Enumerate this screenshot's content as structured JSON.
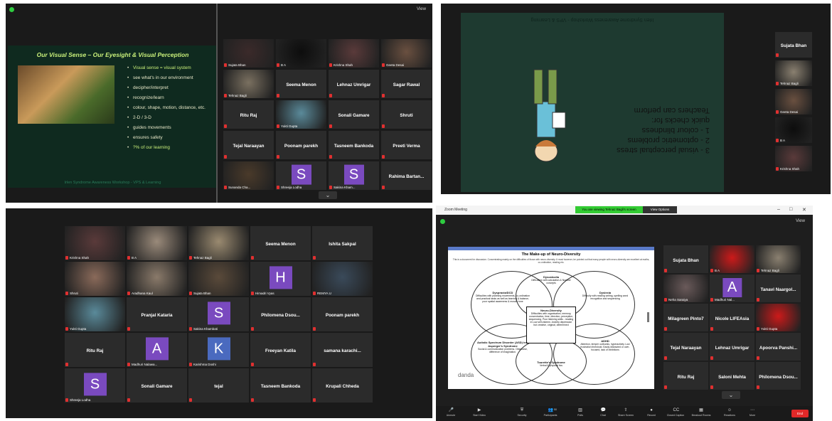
{
  "top_left": {
    "view_label": "View",
    "slide": {
      "title": "Our Visual Sense – Our Eyesight & Visual Perception",
      "bullets": [
        "Visual sense = visual system",
        "see what's in our environment",
        "decipher/interpret",
        "recognize/learn",
        "colour, shape, motion, distance, etc.",
        "2-D / 3-D",
        "guides movements",
        "ensures safety",
        "?% of our learning"
      ],
      "footer": "Irlen Syndrome Awareness Workshop - VPS & Learning"
    },
    "tiles": [
      {
        "name": "Sujata Bhan",
        "type": "video",
        "color": "#3b2a2a"
      },
      {
        "name": "B A",
        "type": "video",
        "color": "#0d0d0d"
      },
      {
        "name": "Krishna Shah",
        "type": "video",
        "color": "#5a3a3a"
      },
      {
        "name": "Geeta Desai",
        "type": "video",
        "color": "#6a5040"
      },
      {
        "name": "Tehnaz Bagli",
        "type": "video",
        "color": "#7a7060",
        "speaker": true
      },
      {
        "name": "Seema Menon",
        "type": "name"
      },
      {
        "name": "Lehnaz Umrigar",
        "type": "name"
      },
      {
        "name": "Sagar Rawal",
        "type": "name"
      },
      {
        "name": "Ritu Raj",
        "type": "name"
      },
      {
        "name": "Yukti Gupta",
        "type": "video",
        "color": "#5a8a9a"
      },
      {
        "name": "Sonali Gamare",
        "type": "name"
      },
      {
        "name": "Shruti",
        "type": "name"
      },
      {
        "name": "Tejal Naraayan",
        "type": "name"
      },
      {
        "name": "Poonam parekh",
        "type": "name"
      },
      {
        "name": "Tasneem Bankoda",
        "type": "name"
      },
      {
        "name": "Preeti Verma",
        "type": "name"
      },
      {
        "name": "Sunanda Cha...",
        "type": "video",
        "color": "#4a3a2a"
      },
      {
        "name": "Shreeja Lodha",
        "type": "letter",
        "letter": "S",
        "color": "#7a4abf"
      },
      {
        "name": "Sakina Kham...",
        "type": "letter",
        "letter": "S",
        "color": "#7a4abf"
      },
      {
        "name": "Rahima Bartan...",
        "type": "name"
      }
    ]
  },
  "top_right": {
    "slide_header": "Irlen Syndrome Awareness Workshop - VPS & Learning",
    "slide_lines": [
      "Teachers can perform",
      "quick checks for:",
      "1 - colour blindness",
      "2 - optometric problems",
      "3 - visual perceptual stress"
    ],
    "tiles": [
      {
        "name": "Sujata Bhan",
        "type": "name"
      },
      {
        "name": "Tehnaz Bagli",
        "type": "video",
        "color": "#8a8070",
        "speaker": true
      },
      {
        "name": "Geeta Desai",
        "type": "video",
        "color": "#6a5040"
      },
      {
        "name": "B A",
        "type": "video",
        "color": "#0d0d0d"
      },
      {
        "name": "Krishna Shah",
        "type": "video",
        "color": "#5a3a3a"
      }
    ]
  },
  "bottom_left": {
    "tiles": [
      {
        "name": "Krishna Shah",
        "type": "video",
        "color": "#5a3a3a"
      },
      {
        "name": "B A",
        "type": "video",
        "color": "#9a8a7a"
      },
      {
        "name": "Tehnaz Bagli",
        "type": "video",
        "color": "#9a8a70",
        "speaker": true
      },
      {
        "name": "Seema Menon",
        "type": "name"
      },
      {
        "name": "Ishita Sakpal",
        "type": "name"
      },
      {
        "name": "Shruti",
        "type": "video",
        "color": "#8a6a5a"
      },
      {
        "name": "Aradhana Kaul",
        "type": "video",
        "color": "#8a7a6a"
      },
      {
        "name": "Sujata Bhan",
        "type": "video",
        "color": "#5a4a3a"
      },
      {
        "name": "Himadri Vyas",
        "type": "letter",
        "letter": "H",
        "color": "#7a4abf"
      },
      {
        "name": "REMYA U",
        "type": "video",
        "color": "#3a4a5a"
      },
      {
        "name": "Yukti Gupta",
        "type": "video",
        "color": "#5a8a9a"
      },
      {
        "name": "Pranjal Kataria",
        "type": "name"
      },
      {
        "name": "Sakina Khambati",
        "type": "letter",
        "letter": "S",
        "color": "#7a4abf"
      },
      {
        "name": "Philomena Dsou...",
        "type": "name"
      },
      {
        "name": "Poonam parekh",
        "type": "name"
      },
      {
        "name": "Ritu Raj",
        "type": "name"
      },
      {
        "name": "Madhuri Nalawa...",
        "type": "letter",
        "letter": "A",
        "color": "#7a4abf"
      },
      {
        "name": "Karishma Doshi",
        "type": "letter",
        "letter": "K",
        "color": "#4a6abf"
      },
      {
        "name": "Freeyan Katila",
        "type": "name"
      },
      {
        "name": "samana karachi...",
        "type": "name"
      },
      {
        "name": "Shreeja Lodha",
        "type": "letter",
        "letter": "S",
        "color": "#7a4abf"
      },
      {
        "name": "Sonali Gamare",
        "type": "name"
      },
      {
        "name": "tejal",
        "type": "name"
      },
      {
        "name": "Tasneem Bankoda",
        "type": "name"
      },
      {
        "name": "Krupali Chheda",
        "type": "name"
      }
    ]
  },
  "zoom_window": {
    "title": "Zoom Meeting",
    "viewing_banner": "You are viewing Tehnaz Bagli's screen",
    "view_options": "View Options",
    "view_label": "View",
    "slide": {
      "title": "The Make-up of Neuro-Diversity",
      "subtitle": "This is a document for discussion. Concentrating mainly on the difficulties of those with neuro-diversity. It must however, be pointed out that many people with neuro-diversity are excellent at maths, co-ordination, reading etc.",
      "boxes": [
        {
          "title": "Dyscalculia",
          "text": "Difficulties with calculation & Number concepts"
        },
        {
          "title": "Dyspraxia/DCD",
          "text": "Difficulties with planning movements, co-ordination and practical tasks as well as learning & balance, poor spatial awareness & muscle tone"
        },
        {
          "title": "Dyslexia",
          "text": "Difficulty with reading writing, spelling word recognition and sequencing"
        },
        {
          "title": "Neuro-Diversity",
          "text": "Difficulties with organisation, memory, concentration, time, direction, perception, sequencing. Poor listening skills - reading in Low self-esteem. Anxiety depression but creative, original, determined"
        },
        {
          "title": "ADHD",
          "text": "Attention, temper outbursts, hyperactivity. Low frustration threshold. Easily distracted or over-focused, lack of inhibitions"
        },
        {
          "title": "Autistic Spectrum Disorder (ASD) inc. Asperger's Syndrome",
          "text": "Social & communication problems. Obsessive, difference of Imagination."
        },
        {
          "title": "Tourette's Syndrome",
          "text": "Verbal & physical tics"
        }
      ],
      "logo": "danda"
    },
    "tiles": [
      {
        "name": "Sujata Bhan",
        "type": "name"
      },
      {
        "name": "B A",
        "type": "video",
        "color": "#cc1a1a"
      },
      {
        "name": "Tehnaz Bagli",
        "type": "video",
        "color": "#8a8070",
        "speaker": true
      },
      {
        "name": "Neha Saraiya",
        "type": "video",
        "color": "#6a5a5a"
      },
      {
        "name": "Madhuri Nal...",
        "type": "letter",
        "letter": "A",
        "color": "#7a4abf"
      },
      {
        "name": "Tanavi Naargol...",
        "type": "name"
      },
      {
        "name": "Milagreen Pinto7",
        "type": "name"
      },
      {
        "name": "Nicole LIFEAsia",
        "type": "name"
      },
      {
        "name": "Yukti Gupta",
        "type": "video",
        "color": "#cc1a1a"
      },
      {
        "name": "Tejal Naraayan",
        "type": "name"
      },
      {
        "name": "Lehnaz Umrigar",
        "type": "name"
      },
      {
        "name": "Apoorva Panshi...",
        "type": "name"
      },
      {
        "name": "Ritu Raj",
        "type": "name"
      },
      {
        "name": "Saloni Mehta",
        "type": "name"
      },
      {
        "name": "Philomena Dsou...",
        "type": "name"
      }
    ],
    "toolbar": [
      {
        "label": "Unmute",
        "icon": "🎤"
      },
      {
        "label": "Start Video",
        "icon": "▶"
      },
      {
        "label": "Security",
        "icon": "⛨"
      },
      {
        "label": "Participants",
        "icon": "👥",
        "count": "50"
      },
      {
        "label": "Polls",
        "icon": "▥"
      },
      {
        "label": "Chat",
        "icon": "💬"
      },
      {
        "label": "Share Screen",
        "icon": "⇧"
      },
      {
        "label": "Record",
        "icon": "●"
      },
      {
        "label": "Closed Caption",
        "icon": "CC"
      },
      {
        "label": "Breakout Rooms",
        "icon": "▦"
      },
      {
        "label": "Reactions",
        "icon": "☺"
      },
      {
        "label": "More",
        "icon": "⋯"
      }
    ],
    "end_label": "End"
  }
}
